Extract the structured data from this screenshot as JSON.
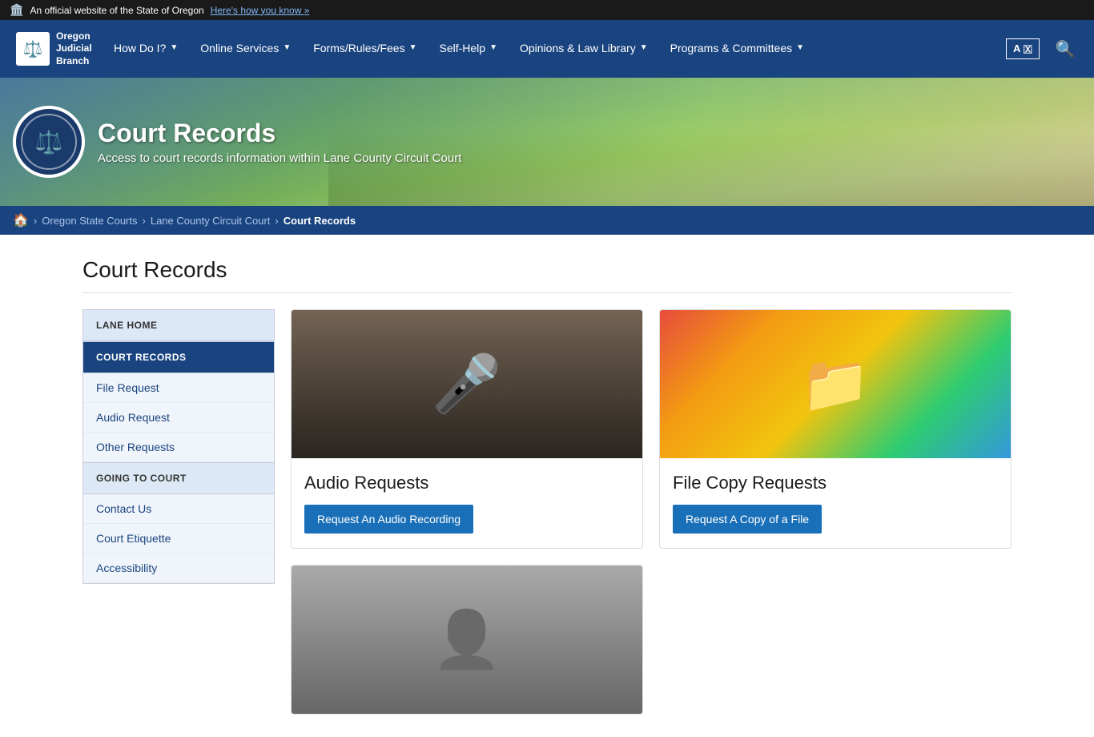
{
  "topbar": {
    "official_text": "An official website of the State of Oregon",
    "link_text": "Here's how you know »"
  },
  "nav": {
    "logo": {
      "line1": "Oregon",
      "line2": "Judicial",
      "line3": "Branch"
    },
    "items": [
      {
        "label": "How Do I?",
        "has_dropdown": true
      },
      {
        "label": "Online Services",
        "has_dropdown": true
      },
      {
        "label": "Forms/Rules/Fees",
        "has_dropdown": true
      },
      {
        "label": "Self-Help",
        "has_dropdown": true
      },
      {
        "label": "Opinions & Law Library",
        "has_dropdown": true
      },
      {
        "label": "Programs & Committees",
        "has_dropdown": true
      }
    ],
    "translate_label": "A🇽",
    "search_icon": "🔍"
  },
  "hero": {
    "title": "Court Records",
    "subtitle": "Access to court records information within Lane County Circuit Court"
  },
  "breadcrumb": {
    "home_icon": "🏠",
    "items": [
      {
        "label": "Oregon State Courts",
        "link": true
      },
      {
        "label": "Lane County Circuit Court",
        "link": true
      },
      {
        "label": "Court Records",
        "link": false
      }
    ]
  },
  "page_title": "Court Records",
  "sidebar": {
    "sections": [
      {
        "id": "lane-home",
        "header": "LANE HOME",
        "items": []
      },
      {
        "id": "court-records",
        "header": "COURT RECORDS",
        "items": [
          {
            "label": "File Request"
          },
          {
            "label": "Audio Request"
          },
          {
            "label": "Other Requests"
          }
        ],
        "active": true
      },
      {
        "id": "going-to-court",
        "header": "GOING TO COURT",
        "items": [
          {
            "label": "Contact Us"
          },
          {
            "label": "Court Etiquette"
          },
          {
            "label": "Accessibility"
          }
        ]
      }
    ]
  },
  "cards": [
    {
      "id": "audio-requests",
      "image_type": "microphone",
      "title": "Audio Requests",
      "button_label": "Request An Audio Recording",
      "alt": "Microphone on stand in courtroom"
    },
    {
      "id": "file-copy-requests",
      "image_type": "folders",
      "title": "File Copy Requests",
      "button_label": "Request A Copy of a File",
      "alt": "Colorful file folders"
    },
    {
      "id": "third-card",
      "image_type": "person",
      "title": "",
      "button_label": "",
      "alt": "Person"
    }
  ]
}
